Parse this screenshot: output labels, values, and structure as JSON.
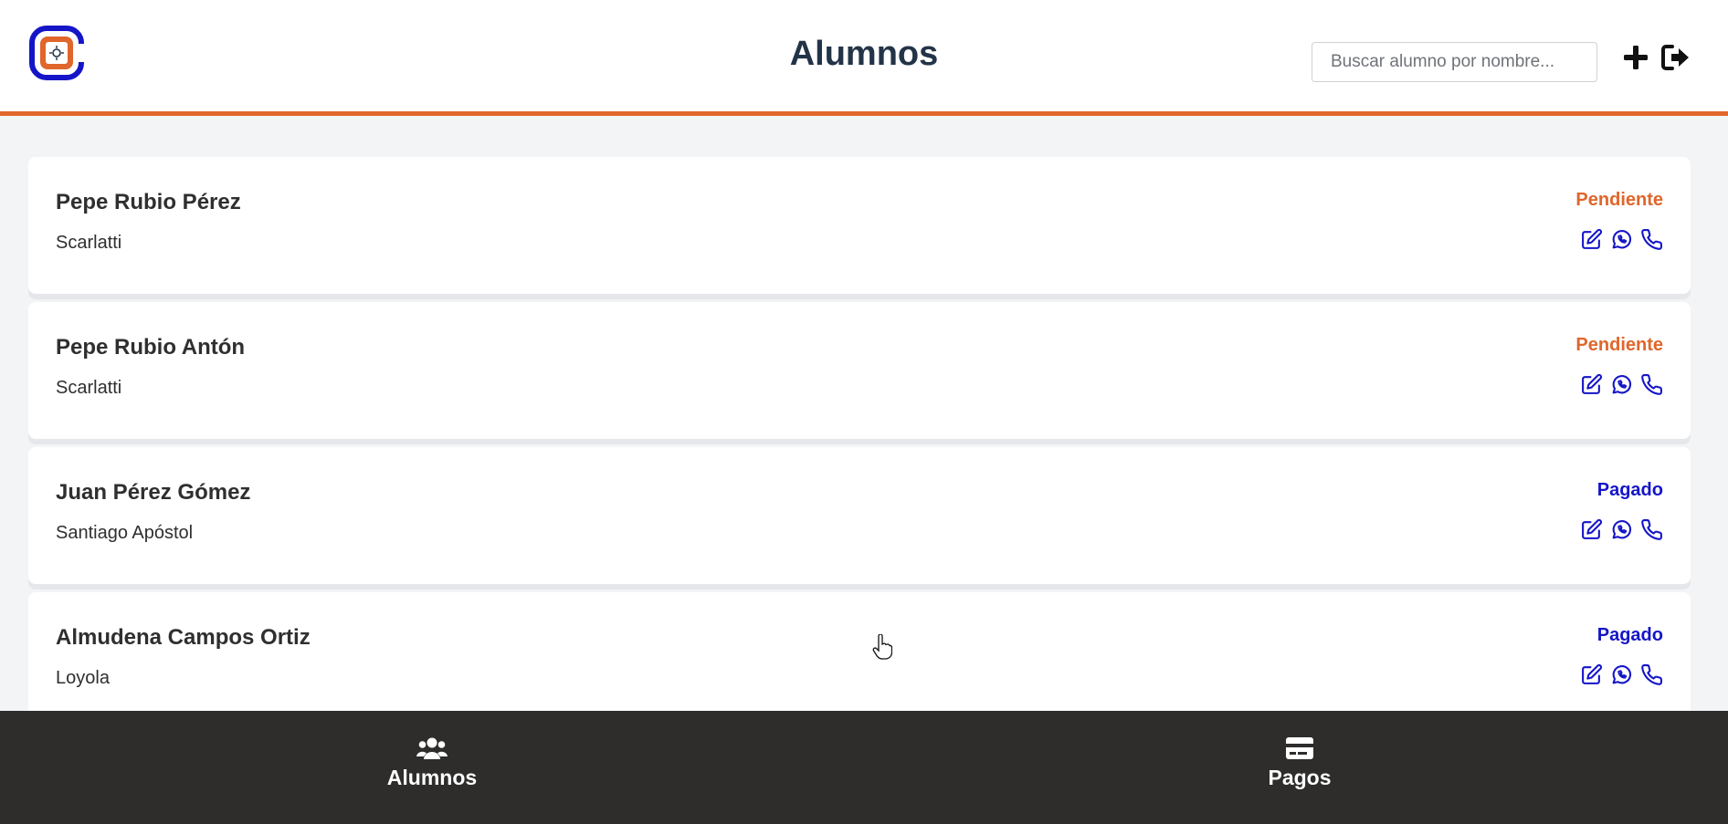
{
  "header": {
    "title": "Alumnos",
    "search": {
      "placeholder": "Buscar alumno por nombre...",
      "value": ""
    },
    "logo_icon": "app-logo-icon",
    "add_icon": "plus-icon",
    "logout_icon": "logout-icon"
  },
  "colors": {
    "accent": "#e0662b",
    "primary": "#1515c8",
    "title": "#233448",
    "nav_bg": "#2e2d2c"
  },
  "students": [
    {
      "name": "Pepe Rubio Pérez",
      "school": "Scarlatti",
      "status": "Pendiente"
    },
    {
      "name": "Pepe Rubio Antón",
      "school": "Scarlatti",
      "status": "Pendiente"
    },
    {
      "name": "Juan Pérez Gómez",
      "school": "Santiago Apóstol",
      "status": "Pagado"
    },
    {
      "name": "Almudena Campos Ortiz",
      "school": "Loyola",
      "status": "Pagado"
    }
  ],
  "card_actions": [
    "edit-icon",
    "whatsapp-icon",
    "phone-icon"
  ],
  "bottom_nav": {
    "alumnos": {
      "label": "Alumnos",
      "icon": "users-icon"
    },
    "pagos": {
      "label": "Pagos",
      "icon": "credit-card-icon"
    }
  }
}
